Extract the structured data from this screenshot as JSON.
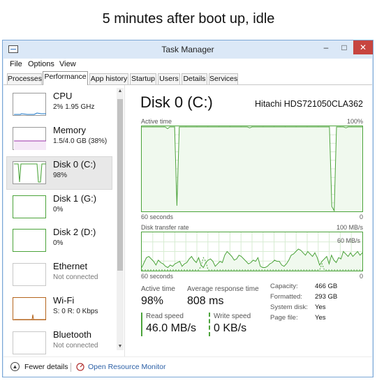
{
  "caption": "5 minutes after boot up, idle",
  "window": {
    "title": "Task Manager",
    "controls": {
      "minimize": "–",
      "maximize": "□",
      "close": "✕"
    }
  },
  "menu": [
    "File",
    "Options",
    "View"
  ],
  "tabs": [
    "Processes",
    "Performance",
    "App history",
    "Startup",
    "Users",
    "Details",
    "Services"
  ],
  "active_tab": "Performance",
  "sidebar": [
    {
      "name": "CPU",
      "sub": "2%  1.95 GHz",
      "color": "#1e78c8"
    },
    {
      "name": "Memory",
      "sub": "1.5/4.0 GB (38%)",
      "color": "#9b30a8"
    },
    {
      "name": "Disk 0 (C:)",
      "sub": "98%",
      "color": "#4ba33a",
      "selected": true
    },
    {
      "name": "Disk 1 (G:)",
      "sub": "0%",
      "color": "#4ba33a"
    },
    {
      "name": "Disk 2 (D:)",
      "sub": "0%",
      "color": "#4ba33a"
    },
    {
      "name": "Ethernet",
      "sub": "Not connected",
      "color": "#c0c0c0"
    },
    {
      "name": "Wi-Fi",
      "sub": "S: 0  R: 0 Kbps",
      "color": "#b5651d"
    },
    {
      "name": "Bluetooth",
      "sub": "Not connected",
      "color": "#c0c0c0"
    }
  ],
  "scroll": {
    "up": "▲",
    "down": "▼"
  },
  "detail": {
    "title": "Disk 0 (C:)",
    "model": "Hitachi HDS721050CLA362",
    "graph1": {
      "label": "Active time",
      "max": "100%",
      "time": "60 seconds",
      "min": "0",
      "series_percent": [
        100,
        100,
        100,
        100,
        100,
        100,
        100,
        100,
        100,
        100,
        100,
        98,
        100,
        100,
        100,
        6,
        100,
        100,
        100,
        100,
        100,
        100,
        100,
        100,
        100,
        100,
        100,
        100,
        100,
        100,
        100,
        100,
        100,
        100,
        100,
        100,
        100,
        100,
        100,
        100,
        100,
        100,
        100,
        100,
        100,
        100,
        99,
        100,
        100,
        100,
        100,
        100,
        100,
        100,
        100,
        100,
        100,
        100,
        100,
        100,
        100,
        100,
        100,
        100,
        100,
        100,
        100,
        100,
        100,
        100,
        100,
        100,
        100,
        100,
        100,
        100,
        100,
        100,
        100,
        100,
        100,
        5,
        0,
        100,
        100,
        100,
        100,
        99,
        100,
        100,
        100,
        100,
        100,
        100,
        100
      ]
    },
    "graph2": {
      "label": "Disk transfer rate",
      "max": "100 MB/s",
      "sublabel": "60 MB/s",
      "time": "60 seconds",
      "min": "0",
      "series_mbps": [
        4,
        12,
        20,
        22,
        18,
        14,
        8,
        16,
        12,
        10,
        6,
        4,
        8,
        6,
        10,
        12,
        14,
        6,
        10,
        12,
        18,
        22,
        16,
        12,
        20,
        8,
        4,
        12,
        16,
        18,
        14,
        6,
        10,
        14,
        12,
        24,
        30,
        26,
        22,
        16,
        18,
        24,
        22,
        18,
        14,
        10,
        12,
        16,
        14,
        20,
        6,
        4,
        4,
        6,
        10,
        12,
        16,
        14,
        14,
        8,
        6,
        10,
        16,
        24,
        26,
        30,
        34,
        32,
        28,
        24,
        30,
        26,
        22,
        28,
        20,
        8,
        14,
        18,
        22,
        10,
        24,
        16,
        12,
        20,
        18,
        30,
        26,
        22,
        28,
        22,
        26,
        30,
        24,
        28
      ],
      "series2_mbps": [
        0,
        0,
        0,
        0,
        0,
        0,
        0,
        0,
        0,
        0,
        0,
        0,
        0,
        0,
        0,
        0,
        0,
        0,
        0,
        0,
        0,
        0,
        0,
        0,
        0,
        6,
        20,
        14,
        0,
        0,
        0,
        0,
        0,
        0,
        0,
        0,
        0,
        0,
        0,
        0,
        0,
        0,
        0,
        0,
        0,
        0,
        0,
        0,
        0,
        0,
        0,
        0,
        0,
        0,
        0,
        0,
        0,
        0,
        0,
        0,
        0,
        0,
        0,
        0,
        0,
        0,
        0,
        0,
        0,
        0,
        0,
        0,
        0,
        0,
        0,
        0,
        10,
        0,
        0,
        0,
        0,
        0,
        0,
        0,
        0,
        0,
        0,
        0,
        0,
        0,
        0,
        0,
        0,
        0
      ]
    },
    "stats": {
      "active_time_label": "Active time",
      "active_time": "98%",
      "avg_response_label": "Average response time",
      "avg_response": "808 ms",
      "read_label": "Read speed",
      "read": "46.0 MB/s",
      "write_label": "Write speed",
      "write": "0 KB/s"
    },
    "properties": [
      {
        "k": "Capacity:",
        "v": "466 GB"
      },
      {
        "k": "Formatted:",
        "v": "293 GB"
      },
      {
        "k": "System disk:",
        "v": "Yes"
      },
      {
        "k": "Page file:",
        "v": "Yes"
      }
    ]
  },
  "footer": {
    "fewer_details": "Fewer details",
    "open_monitor": "Open Resource Monitor"
  },
  "colors": {
    "disk": "#4ba33a",
    "disk_fill": "#f0f9ee",
    "grid": "#d7ecd2"
  }
}
